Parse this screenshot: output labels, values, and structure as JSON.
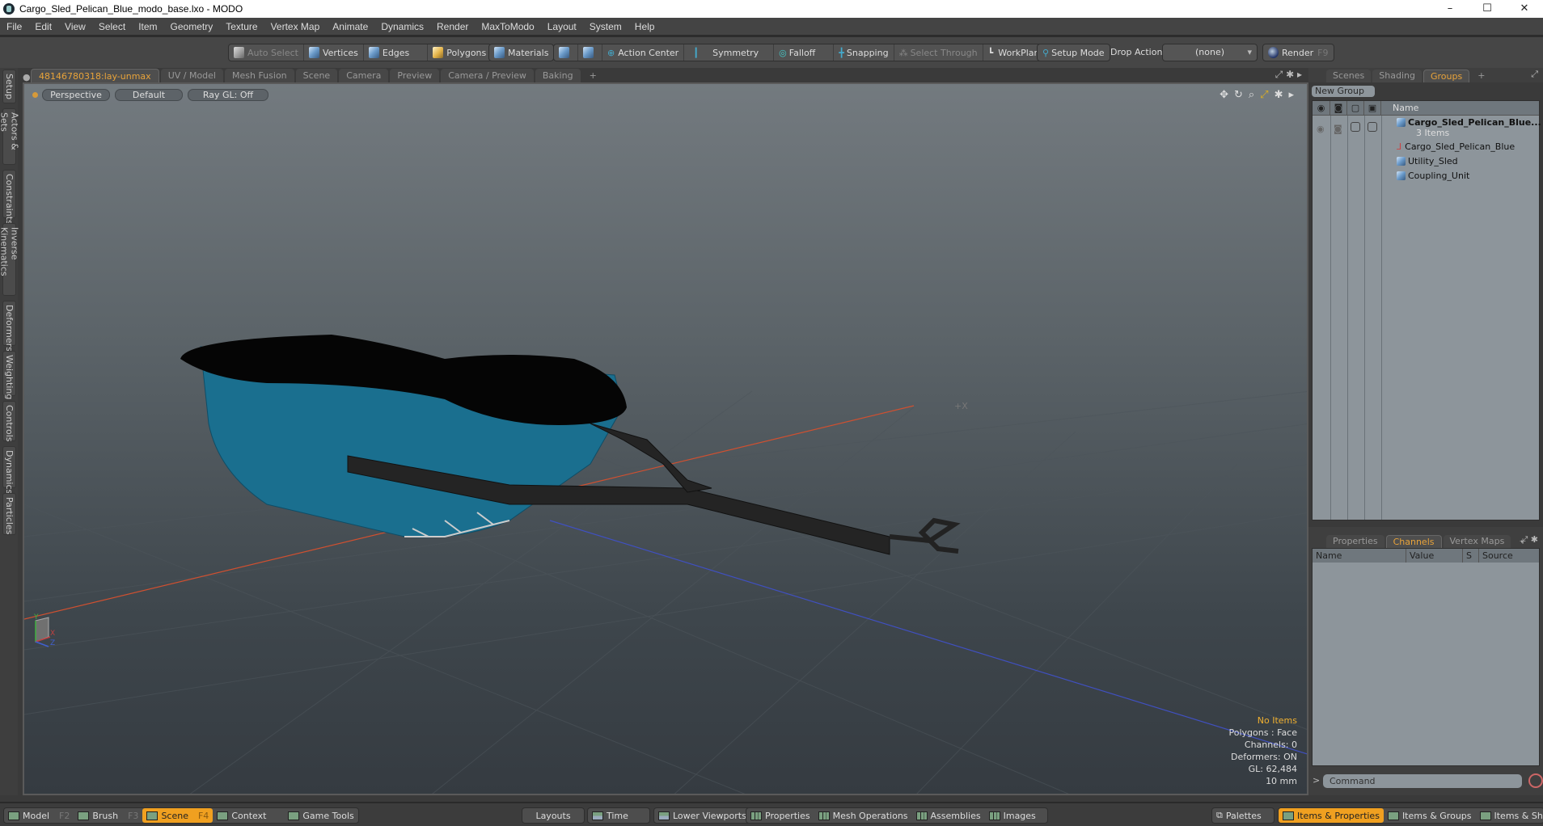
{
  "window": {
    "title": "Cargo_Sled_Pelican_Blue_modo_base.lxo - MODO",
    "controls": [
      "minimize",
      "maximize",
      "close"
    ]
  },
  "menu": [
    "File",
    "Edit",
    "View",
    "Select",
    "Item",
    "Geometry",
    "Texture",
    "Vertex Map",
    "Animate",
    "Dynamics",
    "Render",
    "MaxToModo",
    "Layout",
    "System",
    "Help"
  ],
  "toolbar": {
    "auto_select": "Auto Select",
    "vertices": "Vertices",
    "edges": "Edges",
    "polygons": "Polygons",
    "materials": "Materials",
    "action_center": "Action Center",
    "symmetry": "Symmetry",
    "falloff": "Falloff",
    "snapping": "Snapping",
    "select_through": "Select Through",
    "workplane": "WorkPlane",
    "setup_mode": "Setup Mode",
    "drop_action_label": "Drop Action",
    "drop_action_value": "(none)",
    "render": "Render",
    "render_key": "F9"
  },
  "left_tabs": [
    "Setup",
    "Actors & Sets",
    "Constraints",
    "Inverse Kinematics",
    "Deformers",
    "Weighting",
    "Controls",
    "Dynamics",
    "Particles"
  ],
  "viewport_tabs": {
    "items": [
      "48146780318:lay-unmax",
      "UV / Model",
      "Mesh Fusion",
      "Scene",
      "Camera",
      "Preview",
      "Camera / Preview",
      "Baking"
    ],
    "active": 0,
    "add": "+"
  },
  "viewport": {
    "view": "Perspective",
    "shading": "Default",
    "raygl": "Ray GL: Off",
    "axis_label": "+X",
    "stats": {
      "selection": "No Items",
      "polygons": "Polygons : Face",
      "channels": "Channels: 0",
      "deformers": "Deformers: ON",
      "gl": "GL: 62,484",
      "scale": "10 mm"
    },
    "colors": {
      "sled_body": "#1a6f8f",
      "cover": "#050505",
      "frame": "#242424",
      "x_axis": "#d05030",
      "z_axis": "#4050c0"
    }
  },
  "right_tabs_top": {
    "items": [
      "Scenes",
      "Shading",
      "Groups"
    ],
    "active": 2,
    "add": "+"
  },
  "groups": {
    "new_group": "New Group",
    "name_header": "Name",
    "root": {
      "name": "Cargo_Sled_Pelican_Blue...",
      "count": "3 Items"
    },
    "children": [
      "Cargo_Sled_Pelican_Blue",
      "Utility_Sled",
      "Coupling_Unit"
    ]
  },
  "right_tabs_bottom": {
    "items": [
      "Properties",
      "Channels",
      "Vertex Maps"
    ],
    "active": 1,
    "add": "+"
  },
  "channels": {
    "headers": [
      "Name",
      "Value",
      "S",
      "Source"
    ]
  },
  "command": {
    "prompt": ">",
    "placeholder": "Command"
  },
  "bottom": {
    "modes": [
      {
        "label": "Model",
        "key": "F2"
      },
      {
        "label": "Brush",
        "key": "F3"
      },
      {
        "label": "Scene",
        "key": "F4",
        "active": true
      },
      {
        "label": "Context",
        "key": ""
      },
      {
        "label": "Game Tools",
        "key": ""
      }
    ],
    "layouts": "Layouts",
    "panels": [
      "Time",
      "Lower Viewports",
      "Properties",
      "Mesh Operations",
      "Assemblies",
      "Images"
    ],
    "palettes": "Palettes",
    "right": [
      "Items & Properties",
      "Items & Groups",
      "Items & Shading"
    ],
    "right_active": 0
  }
}
